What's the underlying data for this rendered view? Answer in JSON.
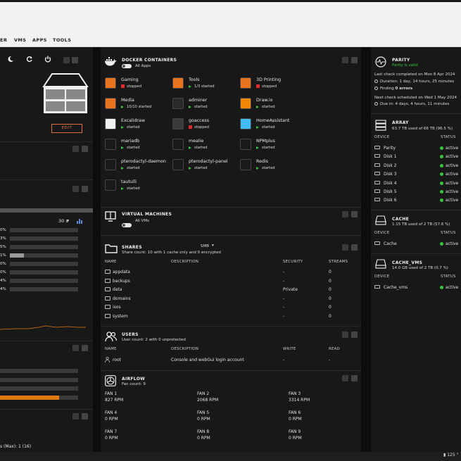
{
  "nav": {
    "items": [
      "ER",
      "VMS",
      "APPS",
      "TOOLS"
    ]
  },
  "left": {
    "edit_label": "EDIT",
    "refresh": "30 s",
    "bars": [
      "0%",
      "3%",
      "5%",
      "1%",
      "0%",
      "0%",
      "4%",
      "4%"
    ],
    "bottom_text": "s (Max): 1 (16)"
  },
  "docker": {
    "title": "DOCKER CONTAINERS",
    "toggle_label": "All Apps",
    "apps": [
      {
        "name": "Gaming",
        "state": "stopped",
        "status": "stopped",
        "color": "#e9731e",
        "link": false
      },
      {
        "name": "Tools",
        "state": "1/3 started",
        "status": "started",
        "color": "#e9731e",
        "link": true
      },
      {
        "name": "3D Printing",
        "state": "stopped",
        "status": "stopped",
        "color": "#e9731e",
        "link": false
      },
      {
        "name": "Media",
        "state": "10/10 started",
        "status": "started",
        "color": "#e9731e",
        "link": false
      },
      {
        "name": "adminer",
        "state": "started",
        "status": "started",
        "color": "#2b2b2b",
        "link": false
      },
      {
        "name": "Draw.io",
        "state": "started",
        "status": "started",
        "color": "#f08705",
        "link": false
      },
      {
        "name": "Excalidraw",
        "state": "started",
        "status": "started",
        "color": "#f2f2f2",
        "link": false
      },
      {
        "name": "goaccess",
        "state": "stopped",
        "status": "stopped",
        "color": "#3a3a3a",
        "link": false
      },
      {
        "name": "HomeAssistant",
        "state": "started",
        "status": "started",
        "color": "#41bdf5",
        "link": false
      },
      {
        "name": "mariadb",
        "state": "started",
        "status": "started",
        "color": "#1a1a1a",
        "link": false
      },
      {
        "name": "mealie",
        "state": "started",
        "status": "started",
        "color": "#1a1a1a",
        "link": false
      },
      {
        "name": "NPMplus",
        "state": "started",
        "status": "started",
        "color": "#1a1a1a",
        "link": false
      },
      {
        "name": "pterodactyl-daemon",
        "state": "started",
        "status": "started",
        "color": "#1a1a1a",
        "link": false
      },
      {
        "name": "pterodactyl-panel",
        "state": "started",
        "status": "started",
        "color": "#1a1a1a",
        "link": false
      },
      {
        "name": "Redis",
        "state": "started",
        "status": "started",
        "color": "#1a1a1a",
        "link": false
      },
      {
        "name": "tautulli",
        "state": "started",
        "status": "started",
        "color": "#1a1a1a",
        "link": false
      }
    ]
  },
  "vms": {
    "title": "VIRTUAL MACHINES",
    "toggle_label": "All VMs"
  },
  "shares": {
    "title": "SHARES",
    "smb_label": "SMB",
    "subtitle": "Share count: 10 with 1 cache only and 0 encrypted",
    "headers": [
      "NAME",
      "DESCRIPTION",
      "SECURITY",
      "STREAMS"
    ],
    "rows": [
      {
        "name": "appdata",
        "desc": "",
        "security": "-",
        "streams": "0"
      },
      {
        "name": "backups",
        "desc": "",
        "security": "-",
        "streams": "0"
      },
      {
        "name": "data",
        "desc": "",
        "security": "Private",
        "streams": "0"
      },
      {
        "name": "domains",
        "desc": "",
        "security": "-",
        "streams": "0"
      },
      {
        "name": "isos",
        "desc": "",
        "security": "-",
        "streams": "0"
      },
      {
        "name": "system",
        "desc": "",
        "security": "-",
        "streams": "0"
      }
    ]
  },
  "users": {
    "title": "USERS",
    "subtitle": "User count: 2 with 0 unprotected",
    "headers": [
      "NAME",
      "DESCRIPTION",
      "WRITE",
      "READ"
    ],
    "rows": [
      {
        "name": "root",
        "desc": "Console and webGui login account",
        "write": "-",
        "read": "-"
      }
    ]
  },
  "airflow": {
    "title": "AIRFLOW",
    "subtitle": "Fan count: 9",
    "fans": [
      {
        "name": "FAN 1",
        "rpm": "827 RPM"
      },
      {
        "name": "FAN 2",
        "rpm": "2068 RPM"
      },
      {
        "name": "FAN 3",
        "rpm": "3314 RPM"
      },
      {
        "name": "FAN 4",
        "rpm": "0 RPM"
      },
      {
        "name": "FAN 5",
        "rpm": "0 RPM"
      },
      {
        "name": "FAN 6",
        "rpm": "0 RPM"
      },
      {
        "name": "FAN 7",
        "rpm": "0 RPM"
      },
      {
        "name": "FAN 8",
        "rpm": "0 RPM"
      },
      {
        "name": "FAN 9",
        "rpm": "0 RPM"
      }
    ]
  },
  "parity": {
    "title": "PARITY",
    "valid": "Parity is valid",
    "last_check": "Last check completed on Mon 8 Apr 2024",
    "duration": "Duration: 1 day, 14 hours, 25 minutes",
    "finding_prefix": "Finding ",
    "finding_value": "0 errors",
    "next_check": "Next check scheduled on Wed 1 May 2024",
    "due": "Due in: 4 days, 4 hours, 11 minutes"
  },
  "array": {
    "title": "ARRAY",
    "subtitle": "63.7 TB used of 66 TB (96.5 %)",
    "headers": [
      "DEVICE",
      "STATUS"
    ],
    "devices": [
      {
        "name": "Parity",
        "status": "active"
      },
      {
        "name": "Disk 1",
        "status": "active"
      },
      {
        "name": "Disk 2",
        "status": "active"
      },
      {
        "name": "Disk 3",
        "status": "active"
      },
      {
        "name": "Disk 4",
        "status": "active"
      },
      {
        "name": "Disk 5",
        "status": "active"
      },
      {
        "name": "Disk 6",
        "status": "active"
      }
    ]
  },
  "cache": {
    "title": "CACHE",
    "subtitle": "1.15 TB used of 2 TB (57.6 %)",
    "headers": [
      "DEVICE",
      "STATUS"
    ],
    "devices": [
      {
        "name": "Cache",
        "status": "active"
      }
    ]
  },
  "cache_vms": {
    "title": "CACHE_VMS",
    "subtitle": "14.0 GB used of 2 TB (0.7 %)",
    "headers": [
      "DEVICE",
      "STATUS"
    ],
    "devices": [
      {
        "name": "Cache_vms",
        "status": "active"
      }
    ]
  },
  "footer": {
    "temp": "125 °"
  }
}
